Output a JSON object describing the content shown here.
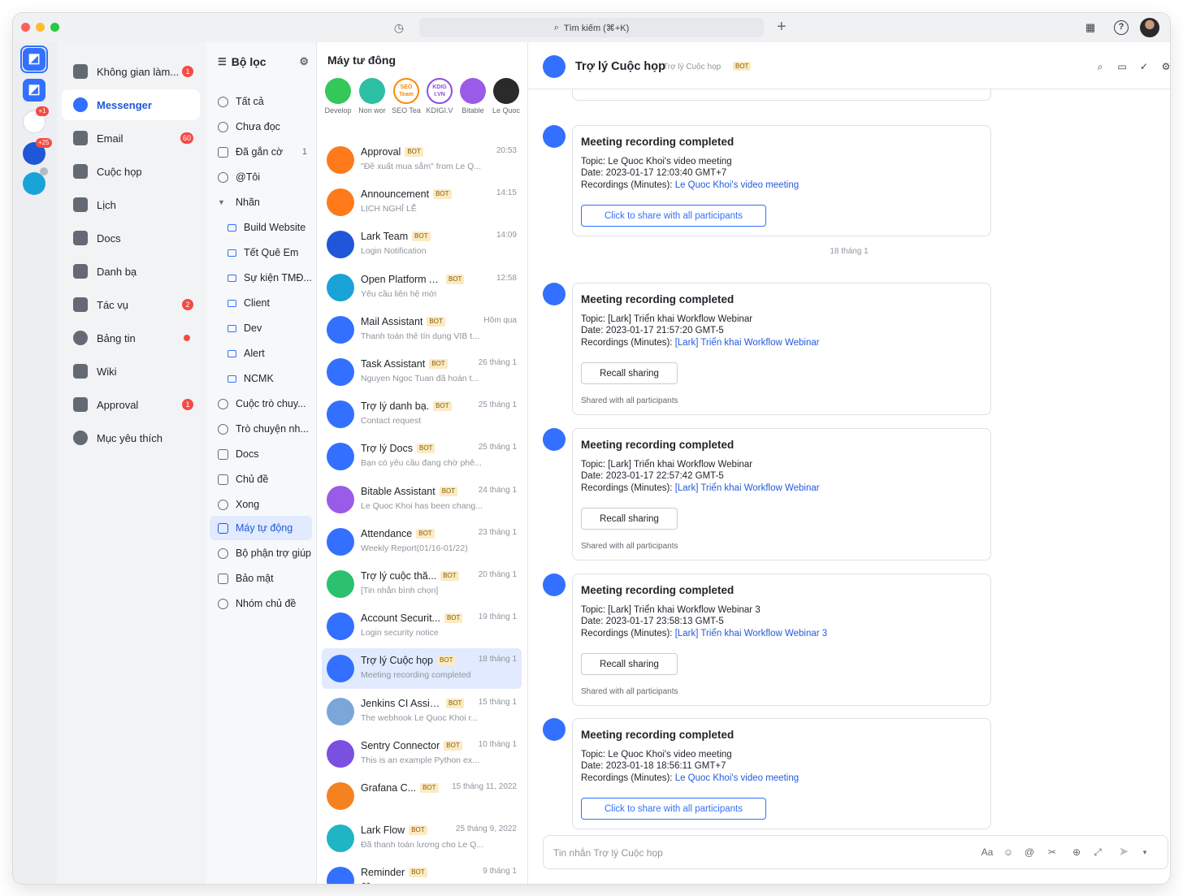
{
  "window": {
    "search_label": "Tìm kiếm (⌘+K)"
  },
  "rail": {
    "badges": [
      "+1",
      "+25"
    ]
  },
  "nav": {
    "items": [
      {
        "label": "Không gian làm...",
        "badge": "1"
      },
      {
        "label": "Messenger",
        "badge": ""
      },
      {
        "label": "Email",
        "badge": "60"
      },
      {
        "label": "Cuộc họp",
        "badge": ""
      },
      {
        "label": "Lịch",
        "badge": ""
      },
      {
        "label": "Docs",
        "badge": ""
      },
      {
        "label": "Danh bạ",
        "badge": ""
      },
      {
        "label": "Tác vụ",
        "badge": "2"
      },
      {
        "label": "Bảng tin",
        "badge": ""
      },
      {
        "label": "Wiki",
        "badge": ""
      },
      {
        "label": "Approval",
        "badge": "1"
      },
      {
        "label": "Mục yêu thích",
        "badge": ""
      }
    ]
  },
  "filter": {
    "title": "Bộ lọc",
    "items": [
      {
        "label": "Tất cả",
        "count": ""
      },
      {
        "label": "Chưa đọc",
        "count": ""
      },
      {
        "label": "Đã gắn cờ",
        "count": "1"
      },
      {
        "label": "@Tôi",
        "count": ""
      },
      {
        "label": "Nhãn",
        "count": ""
      },
      {
        "label": "Build Website",
        "count": ""
      },
      {
        "label": "Tết Quê Em",
        "count": ""
      },
      {
        "label": "Sự kiện TMĐ...",
        "count": ""
      },
      {
        "label": "Client",
        "count": ""
      },
      {
        "label": "Dev",
        "count": ""
      },
      {
        "label": "Alert",
        "count": ""
      },
      {
        "label": "NCMK",
        "count": ""
      },
      {
        "label": "Cuộc trò chuy...",
        "count": ""
      },
      {
        "label": "Trò chuyện nh...",
        "count": ""
      },
      {
        "label": "Docs",
        "count": ""
      },
      {
        "label": "Chủ đề",
        "count": ""
      },
      {
        "label": "Xong",
        "count": ""
      },
      {
        "label": "Máy tự động",
        "count": ""
      },
      {
        "label": "Bộ phận trợ giúp",
        "count": ""
      },
      {
        "label": "Bảo mật",
        "count": ""
      },
      {
        "label": "Nhóm chủ đề",
        "count": ""
      }
    ]
  },
  "chatlist": {
    "title": "Máy tư đông",
    "quick": [
      {
        "label": "Develop",
        "avatar_text": "",
        "color": "#34c759"
      },
      {
        "label": "Non wor",
        "avatar_text": "",
        "color": "#2dbfa3"
      },
      {
        "label": "SEO Tea",
        "avatar_text": "SEO Team",
        "color": "#ff8800"
      },
      {
        "label": "KDIGI.V",
        "avatar_text": "KDIG I.VN",
        "color": "#8a4fe0"
      },
      {
        "label": "Bitable",
        "avatar_text": "",
        "color": "#9a5be8"
      },
      {
        "label": "Le Quoc",
        "avatar_text": "",
        "color": "#2a2a2a"
      }
    ],
    "bot_tag": "BOT",
    "rows": [
      {
        "name": "Approval",
        "time": "20:53",
        "preview": "\"Đề xuất mua sắm\" from Le Q...",
        "color": "#ff7a1a"
      },
      {
        "name": "Announcement",
        "time": "14:15",
        "preview": "LỊCH NGHỈ LỄ",
        "color": "#ff7a1a"
      },
      {
        "name": "Lark Team",
        "time": "14:09",
        "preview": "Login Notification",
        "color": "#1f57d8"
      },
      {
        "name": "Open Platform Assis...",
        "time": "12:58",
        "preview": "Yêu cầu liên hệ mới",
        "color": "#1aa3d8"
      },
      {
        "name": "Mail Assistant",
        "time": "Hôm qua",
        "preview": "Thanh toán thẻ tín dụng VIB t...",
        "color": "#3370ff"
      },
      {
        "name": "Task Assistant",
        "time": "26 tháng 1",
        "preview": "Nguyen Ngoc Tuan đã hoàn t...",
        "color": "#3370ff"
      },
      {
        "name": "Trợ lý danh bạ.",
        "time": "25 tháng 1",
        "preview": "Contact request",
        "color": "#3370ff"
      },
      {
        "name": "Trợ lý Docs",
        "time": "25 tháng 1",
        "preview": "Bạn có yêu cầu đang chờ phê...",
        "color": "#3370ff"
      },
      {
        "name": "Bitable Assistant",
        "time": "24 tháng 1",
        "preview": "Le Quoc Khoi has been chang...",
        "color": "#9a5be8"
      },
      {
        "name": "Attendance",
        "time": "23 tháng 1",
        "preview": "Weekly Report(01/16-01/22)",
        "color": "#3370ff"
      },
      {
        "name": "Trợ lý cuộc thă...",
        "time": "20 tháng 1",
        "preview": "[Tin nhắn bình chọn]",
        "color": "#2bc16f"
      },
      {
        "name": "Account Securit...",
        "time": "19 tháng 1",
        "preview": "Login security notice",
        "color": "#3370ff"
      },
      {
        "name": "Trợ lý Cuộc họp",
        "time": "18 tháng 1",
        "preview": "Meeting recording completed",
        "color": "#3370ff"
      },
      {
        "name": "Jenkins CI Assis...",
        "time": "15 tháng 1",
        "preview": "The webhook Le Quoc Khoi r...",
        "color": "#7aa6d8"
      },
      {
        "name": "Sentry Connector",
        "time": "10 tháng 1",
        "preview": "This is an example Python ex...",
        "color": "#7b4fe0"
      },
      {
        "name": "Grafana C...",
        "time": "15 tháng 11, 2022",
        "preview": "",
        "color": "#f5821f"
      },
      {
        "name": "Lark Flow",
        "time": "25 tháng 9, 2022",
        "preview": "Đã thanh toán lương cho Le Q...",
        "color": "#1fb5c4"
      },
      {
        "name": "Reminder",
        "time": "9 tháng 1",
        "preview": "⏰Mới phát hiện cái phone fiel...",
        "color": "#3370ff"
      }
    ]
  },
  "chat": {
    "title": "Trợ lý Cuộc họp",
    "subtitle": "Trợ lý Cuộc họp",
    "bot_tag": "BOT",
    "date_divider": "18 tháng 1",
    "composer_placeholder": "Tin nhắn Trợ lý Cuộc họp",
    "composer_font_label": "Aa",
    "messages": [
      {
        "title": "Meeting recording completed",
        "topic": "Topic: Le Quoc Khoi's video meeting",
        "date": "Date: 2023-01-17 12:03:40 GMT+7",
        "rec_label": "Recordings (Minutes):",
        "rec_link": "Le Quoc Khoi's video meeting",
        "button": "Click to share with all participants",
        "note": ""
      },
      {
        "title": "Meeting recording completed",
        "topic": "Topic: [Lark] Triển khai Workflow Webinar",
        "date": "Date: 2023-01-17 21:57:20 GMT-5",
        "rec_label": "Recordings (Minutes):",
        "rec_link": "[Lark] Triển khai Workflow Webinar",
        "button": "Recall sharing",
        "note": "Shared with all participants"
      },
      {
        "title": "Meeting recording completed",
        "topic": "Topic: [Lark] Triển khai Workflow Webinar",
        "date": "Date: 2023-01-17 22:57:42 GMT-5",
        "rec_label": "Recordings (Minutes):",
        "rec_link": "[Lark] Triển khai Workflow Webinar",
        "button": "Recall sharing",
        "note": "Shared with all participants"
      },
      {
        "title": "Meeting recording completed",
        "topic": "Topic: [Lark] Triển khai Workflow Webinar 3",
        "date": "Date: 2023-01-17 23:58:13 GMT-5",
        "rec_label": "Recordings (Minutes):",
        "rec_link": "[Lark] Triển khai Workflow Webinar 3",
        "button": "Recall sharing",
        "note": "Shared with all participants"
      },
      {
        "title": "Meeting recording completed",
        "topic": "Topic: Le Quoc Khoi's video meeting",
        "date": "Date: 2023-01-18 18:56:11 GMT+7",
        "rec_label": "Recordings (Minutes):",
        "rec_link": "Le Quoc Khoi's video meeting",
        "button": "Click to share with all participants",
        "note": ""
      }
    ]
  },
  "colors": {
    "accent": "#3370ff",
    "badge": "#f54a45",
    "bot_tag_bg": "#fbeac3"
  }
}
